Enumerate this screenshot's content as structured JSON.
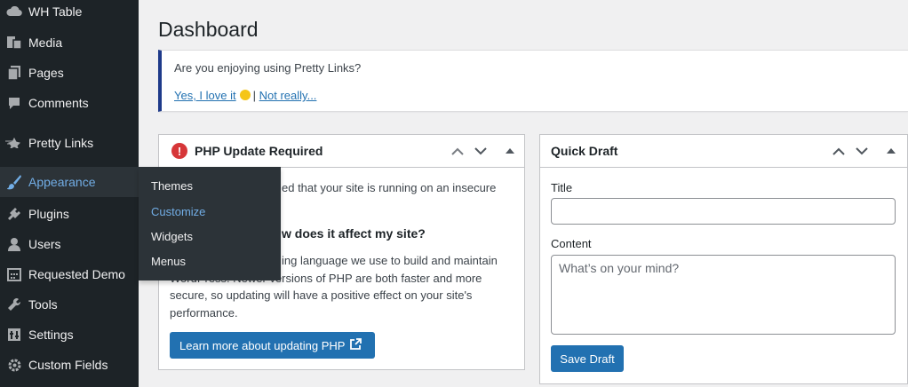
{
  "sidebar": {
    "items": [
      {
        "label": "WH Table",
        "icon": "cloud-icon"
      },
      {
        "label": "Media",
        "icon": "media-icon"
      },
      {
        "label": "Pages",
        "icon": "pages-icon"
      },
      {
        "label": "Comments",
        "icon": "comment-icon"
      },
      {
        "label": "Pretty Links",
        "icon": "star-icon"
      },
      {
        "label": "Appearance",
        "icon": "paintbrush-icon"
      },
      {
        "label": "Plugins",
        "icon": "plugin-icon"
      },
      {
        "label": "Users",
        "icon": "users-icon"
      },
      {
        "label": "Requested Demo",
        "icon": "calendar-icon"
      },
      {
        "label": "Tools",
        "icon": "wrench-icon"
      },
      {
        "label": "Settings",
        "icon": "settings-icon"
      },
      {
        "label": "Custom Fields",
        "icon": "gear-icon"
      }
    ],
    "flyout": [
      "Themes",
      "Customize",
      "Widgets",
      "Menus"
    ]
  },
  "page": {
    "title": "Dashboard"
  },
  "notice": {
    "question": "Are you enjoying using Pretty Links?",
    "yes": "Yes, I love it",
    "separator": "|",
    "no": "Not really..."
  },
  "php_box": {
    "title": "PHP Update Required",
    "line1": "ed that your site is running on an insecure",
    "heading": "w does it affect my site?",
    "line2": "ing language we use to build and maintain",
    "line3": "WordPress. Newer versions of PHP are both faster and more",
    "line4": "secure, so updating will have a positive effect on your site's",
    "line5": "performance.",
    "button": "Learn more about updating PHP"
  },
  "quick_draft": {
    "title": "Quick Draft",
    "title_label": "Title",
    "title_value": "",
    "content_label": "Content",
    "content_placeholder": "What’s on your mind?",
    "save": "Save Draft"
  },
  "colors": {
    "sidebar": "#1d2327",
    "accent": "#2271b1",
    "active": "#72aee6",
    "error": "#d63638",
    "notice_border": "#1e3a8a"
  }
}
